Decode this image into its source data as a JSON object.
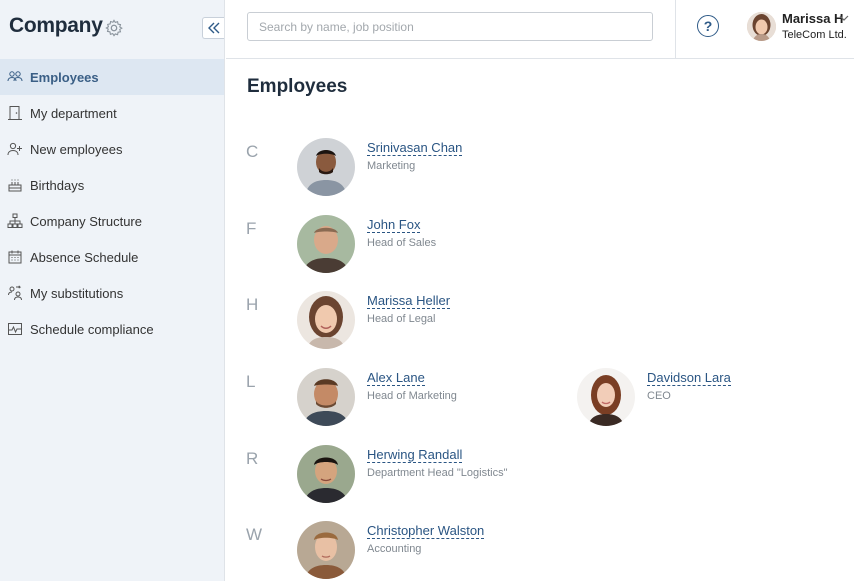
{
  "sidebar": {
    "title": "Company",
    "items": [
      {
        "label": "Employees",
        "icon": "people-icon",
        "active": true
      },
      {
        "label": "My department",
        "icon": "door-icon"
      },
      {
        "label": "New employees",
        "icon": "add-user-icon"
      },
      {
        "label": "Birthdays",
        "icon": "cake-icon"
      },
      {
        "label": "Company Structure",
        "icon": "org-chart-icon"
      },
      {
        "label": "Absence Schedule",
        "icon": "calendar-icon"
      },
      {
        "label": "My substitutions",
        "icon": "substitution-icon"
      },
      {
        "label": "Schedule compliance",
        "icon": "pulse-chart-icon"
      }
    ]
  },
  "header": {
    "search_placeholder": "Search by name, job position",
    "user": {
      "name": "Marissa H",
      "company": "TeleCom Ltd."
    },
    "help_label": "?"
  },
  "main": {
    "title": "Employees",
    "groups": [
      {
        "letter": "C",
        "employees": [
          {
            "name": "Srinivasan Chan",
            "role": "Marketing"
          }
        ]
      },
      {
        "letter": "F",
        "employees": [
          {
            "name": "John Fox",
            "role": "Head of Sales"
          }
        ]
      },
      {
        "letter": "H",
        "employees": [
          {
            "name": "Marissa Heller",
            "role": "Head of Legal"
          }
        ]
      },
      {
        "letter": "L",
        "employees": [
          {
            "name": "Alex Lane",
            "role": "Head of Marketing"
          },
          {
            "name": "Davidson Lara",
            "role": "CEO"
          }
        ]
      },
      {
        "letter": "R",
        "employees": [
          {
            "name": "Herwing Randall",
            "role": "Department Head \"Logistics\""
          }
        ]
      },
      {
        "letter": "W",
        "employees": [
          {
            "name": "Christopher Walston",
            "role": "Accounting"
          }
        ]
      }
    ]
  },
  "colors": {
    "accent": "#2a5583",
    "sidebar_bg": "#eff3f8",
    "active_bg": "#dde7f2"
  }
}
